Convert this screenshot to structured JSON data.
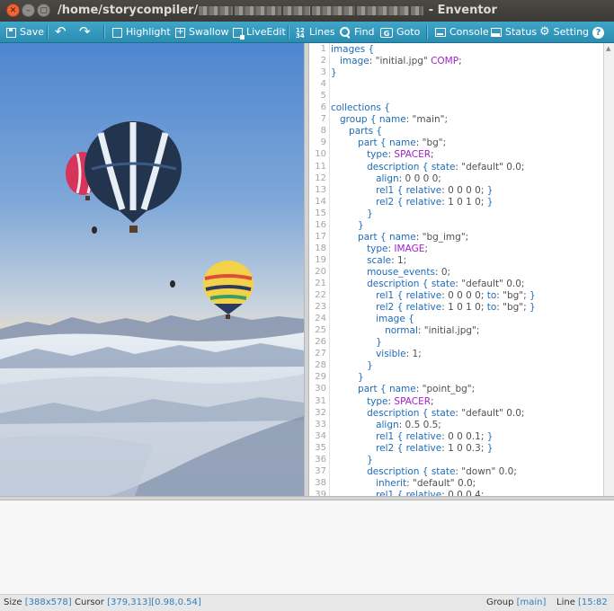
{
  "window": {
    "title_prefix": "/home/storycompiler/",
    "title_suffix": " - Enventor"
  },
  "toolbar": {
    "save": "Save",
    "highlight": "Highlight",
    "swallow": "Swallow",
    "liveedit": "LiveEdit",
    "lines": "Lines",
    "find": "Find",
    "goto": "Goto",
    "console": "Console",
    "status": "Status",
    "setting": "Setting",
    "help": "?"
  },
  "editor": {
    "lines": [
      {
        "n": "1",
        "t": [
          [
            "k",
            "images "
          ],
          [
            "p",
            "{"
          ]
        ]
      },
      {
        "n": "2",
        "t": [
          [
            "s",
            "   "
          ],
          [
            "k",
            "image"
          ],
          [
            "s",
            ": \"initial.jpg\" "
          ],
          [
            "c",
            "COMP"
          ],
          [
            "s",
            ";"
          ]
        ]
      },
      {
        "n": "3",
        "t": [
          [
            "p",
            "}"
          ]
        ]
      },
      {
        "n": "4",
        "t": []
      },
      {
        "n": "5",
        "t": []
      },
      {
        "n": "6",
        "t": [
          [
            "k",
            "collections "
          ],
          [
            "p",
            "{"
          ]
        ]
      },
      {
        "n": "7",
        "t": [
          [
            "s",
            "   "
          ],
          [
            "k",
            "group "
          ],
          [
            "p",
            "{ "
          ],
          [
            "k",
            "name"
          ],
          [
            "s",
            ": \"main\";"
          ]
        ]
      },
      {
        "n": "8",
        "t": [
          [
            "s",
            "      "
          ],
          [
            "k",
            "parts "
          ],
          [
            "p",
            "{"
          ]
        ]
      },
      {
        "n": "9",
        "t": [
          [
            "s",
            "         "
          ],
          [
            "k",
            "part "
          ],
          [
            "p",
            "{ "
          ],
          [
            "k",
            "name"
          ],
          [
            "s",
            ": \"bg\";"
          ]
        ]
      },
      {
        "n": "10",
        "t": [
          [
            "s",
            "            "
          ],
          [
            "k",
            "type"
          ],
          [
            "s",
            ": "
          ],
          [
            "c",
            "SPACER"
          ],
          [
            "s",
            ";"
          ]
        ]
      },
      {
        "n": "11",
        "t": [
          [
            "s",
            "            "
          ],
          [
            "k",
            "description "
          ],
          [
            "p",
            "{ "
          ],
          [
            "k",
            "state"
          ],
          [
            "s",
            ": \"default\" 0.0;"
          ]
        ]
      },
      {
        "n": "12",
        "t": [
          [
            "s",
            "               "
          ],
          [
            "k",
            "align"
          ],
          [
            "s",
            ": 0 0 0 0;"
          ]
        ]
      },
      {
        "n": "13",
        "t": [
          [
            "s",
            "               "
          ],
          [
            "k",
            "rel1 "
          ],
          [
            "p",
            "{ "
          ],
          [
            "k",
            "relative"
          ],
          [
            "s",
            ": 0 0 0 0; "
          ],
          [
            "p",
            "}"
          ]
        ]
      },
      {
        "n": "14",
        "t": [
          [
            "s",
            "               "
          ],
          [
            "k",
            "rel2 "
          ],
          [
            "p",
            "{ "
          ],
          [
            "k",
            "relative"
          ],
          [
            "s",
            ": 1 0 1 0; "
          ],
          [
            "p",
            "}"
          ]
        ]
      },
      {
        "n": "15",
        "t": [
          [
            "s",
            "            "
          ],
          [
            "p",
            "}"
          ]
        ]
      },
      {
        "n": "16",
        "t": [
          [
            "s",
            "         "
          ],
          [
            "p",
            "}"
          ]
        ]
      },
      {
        "n": "17",
        "t": [
          [
            "s",
            "         "
          ],
          [
            "k",
            "part "
          ],
          [
            "p",
            "{ "
          ],
          [
            "k",
            "name"
          ],
          [
            "s",
            ": \"bg_img\";"
          ]
        ]
      },
      {
        "n": "18",
        "t": [
          [
            "s",
            "            "
          ],
          [
            "k",
            "type"
          ],
          [
            "s",
            ": "
          ],
          [
            "c",
            "IMAGE"
          ],
          [
            "s",
            ";"
          ]
        ]
      },
      {
        "n": "19",
        "t": [
          [
            "s",
            "            "
          ],
          [
            "k",
            "scale"
          ],
          [
            "s",
            ": 1;"
          ]
        ]
      },
      {
        "n": "20",
        "t": [
          [
            "s",
            "            "
          ],
          [
            "k",
            "mouse_events"
          ],
          [
            "s",
            ": 0;"
          ]
        ]
      },
      {
        "n": "21",
        "t": [
          [
            "s",
            "            "
          ],
          [
            "k",
            "description "
          ],
          [
            "p",
            "{ "
          ],
          [
            "k",
            "state"
          ],
          [
            "s",
            ": \"default\" 0.0;"
          ]
        ]
      },
      {
        "n": "22",
        "t": [
          [
            "s",
            "               "
          ],
          [
            "k",
            "rel1 "
          ],
          [
            "p",
            "{ "
          ],
          [
            "k",
            "relative"
          ],
          [
            "s",
            ": 0 0 0 0; "
          ],
          [
            "k",
            "to"
          ],
          [
            "s",
            ": \"bg\"; "
          ],
          [
            "p",
            "}"
          ]
        ]
      },
      {
        "n": "23",
        "t": [
          [
            "s",
            "               "
          ],
          [
            "k",
            "rel2 "
          ],
          [
            "p",
            "{ "
          ],
          [
            "k",
            "relative"
          ],
          [
            "s",
            ": 1 0 1 0; "
          ],
          [
            "k",
            "to"
          ],
          [
            "s",
            ": \"bg\"; "
          ],
          [
            "p",
            "}"
          ]
        ]
      },
      {
        "n": "24",
        "t": [
          [
            "s",
            "               "
          ],
          [
            "k",
            "image "
          ],
          [
            "p",
            "{"
          ]
        ]
      },
      {
        "n": "25",
        "t": [
          [
            "s",
            "                  "
          ],
          [
            "k",
            "normal"
          ],
          [
            "s",
            ": \"initial.jpg\";"
          ]
        ]
      },
      {
        "n": "26",
        "t": [
          [
            "s",
            "               "
          ],
          [
            "p",
            "}"
          ]
        ]
      },
      {
        "n": "27",
        "t": [
          [
            "s",
            "               "
          ],
          [
            "k",
            "visible"
          ],
          [
            "s",
            ": 1;"
          ]
        ]
      },
      {
        "n": "28",
        "t": [
          [
            "s",
            "            "
          ],
          [
            "p",
            "}"
          ]
        ]
      },
      {
        "n": "29",
        "t": [
          [
            "s",
            "         "
          ],
          [
            "p",
            "}"
          ]
        ]
      },
      {
        "n": "30",
        "t": [
          [
            "s",
            "         "
          ],
          [
            "k",
            "part "
          ],
          [
            "p",
            "{ "
          ],
          [
            "k",
            "name"
          ],
          [
            "s",
            ": \"point_bg\";"
          ]
        ]
      },
      {
        "n": "31",
        "t": [
          [
            "s",
            "            "
          ],
          [
            "k",
            "type"
          ],
          [
            "s",
            ": "
          ],
          [
            "c",
            "SPACER"
          ],
          [
            "s",
            ";"
          ]
        ]
      },
      {
        "n": "32",
        "t": [
          [
            "s",
            "            "
          ],
          [
            "k",
            "description "
          ],
          [
            "p",
            "{ "
          ],
          [
            "k",
            "state"
          ],
          [
            "s",
            ": \"default\" 0.0;"
          ]
        ]
      },
      {
        "n": "33",
        "t": [
          [
            "s",
            "               "
          ],
          [
            "k",
            "align"
          ],
          [
            "s",
            ": 0.5 0.5;"
          ]
        ]
      },
      {
        "n": "34",
        "t": [
          [
            "s",
            "               "
          ],
          [
            "k",
            "rel1 "
          ],
          [
            "p",
            "{ "
          ],
          [
            "k",
            "relative"
          ],
          [
            "s",
            ": 0 0 0.1; "
          ],
          [
            "p",
            "}"
          ]
        ]
      },
      {
        "n": "35",
        "t": [
          [
            "s",
            "               "
          ],
          [
            "k",
            "rel2 "
          ],
          [
            "p",
            "{ "
          ],
          [
            "k",
            "relative"
          ],
          [
            "s",
            ": 1 0 0.3; "
          ],
          [
            "p",
            "}"
          ]
        ]
      },
      {
        "n": "36",
        "t": [
          [
            "s",
            "            "
          ],
          [
            "p",
            "}"
          ]
        ]
      },
      {
        "n": "37",
        "t": [
          [
            "s",
            "            "
          ],
          [
            "k",
            "description "
          ],
          [
            "p",
            "{ "
          ],
          [
            "k",
            "state"
          ],
          [
            "s",
            ": \"down\" 0.0;"
          ]
        ]
      },
      {
        "n": "38",
        "t": [
          [
            "s",
            "               "
          ],
          [
            "k",
            "inherit"
          ],
          [
            "s",
            ": \"default\" 0.0;"
          ]
        ]
      },
      {
        "n": "39",
        "t": [
          [
            "s",
            "               "
          ],
          [
            "k",
            "rel1 "
          ],
          [
            "p",
            "{ "
          ],
          [
            "k",
            "relative"
          ],
          [
            "s",
            ": 0 0 0.4;"
          ]
        ]
      }
    ]
  },
  "status": {
    "size_label": "Size ",
    "size_value": "[388x578]",
    "cursor_label": "Cursor ",
    "cursor_value": "[379,313]",
    "cursor_rel": "[0.98,0.54]",
    "group_label": "Group ",
    "group_value": "[main]",
    "line_label": "Line ",
    "line_value": "[15:82"
  },
  "colors": {
    "toolbar": "#2f97bc",
    "keyword": "#1e6bb8",
    "constant": "#a020c8",
    "status_value": "#2f7fc0"
  }
}
